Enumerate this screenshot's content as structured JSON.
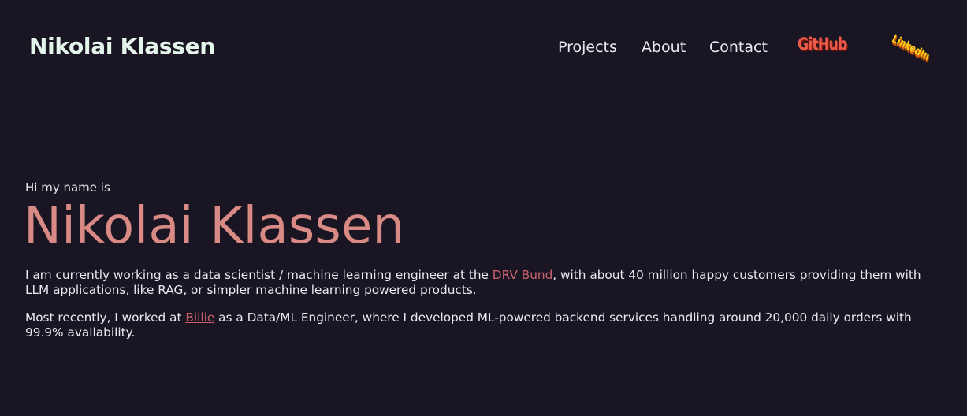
{
  "header": {
    "brand": "Nikolai Klassen",
    "nav": {
      "projects": "Projects",
      "about": "About",
      "contact": "Contact"
    },
    "social": {
      "github": "GitHub",
      "linkedin": "LinkedIn"
    }
  },
  "hero": {
    "greeting": "Hi my name is",
    "name": "Nikolai Klassen",
    "paragraph1": {
      "before": "I am currently working as a data scientist / machine learning engineer at the ",
      "link": "DRV Bund",
      "after": ", with about 40 million happy customers providing them with LLM applications, like RAG, or simpler machine learning powered products."
    },
    "paragraph2": {
      "before": "Most recently, I worked at ",
      "link": "Billie",
      "after": " as a Data/ML Engineer, where I developed ML-powered backend services handling around 20,000 daily orders with 99.9% availability."
    }
  },
  "colors": {
    "background": "#191522",
    "accent": "#d98a84",
    "link": "#c9636d",
    "brand": "#e4f5ec"
  }
}
